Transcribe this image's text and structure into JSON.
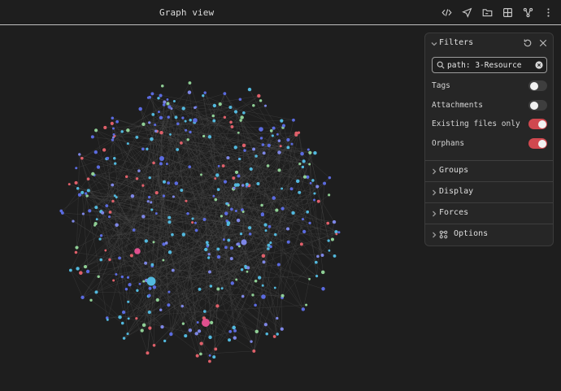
{
  "header": {
    "title": "Graph view",
    "toolbar": [
      {
        "name": "code-icon",
        "label": "Source mode"
      },
      {
        "name": "navigate-icon",
        "label": "Navigate"
      },
      {
        "name": "folder-icon",
        "label": "Folder"
      },
      {
        "name": "grid-icon",
        "label": "Layout"
      },
      {
        "name": "graph-icon",
        "label": "Graph"
      },
      {
        "name": "more-icon",
        "label": "More options"
      }
    ]
  },
  "filters": {
    "title": "Filters",
    "search_value": "path: 3-Resource",
    "toggles": [
      {
        "label": "Tags",
        "on": false
      },
      {
        "label": "Attachments",
        "on": false
      },
      {
        "label": "Existing files only",
        "on": true
      },
      {
        "label": "Orphans",
        "on": true
      }
    ]
  },
  "sections": {
    "groups": "Groups",
    "display": "Display",
    "forces": "Forces",
    "options": "Options"
  },
  "colors": {
    "background": "#1e1e1e",
    "toggle_on": "#d0484f",
    "node_blue": "#5b6be0",
    "node_periwinkle": "#7d86e6",
    "node_cyan": "#52b9de",
    "node_green": "#8fcf95",
    "node_red": "#e0606a",
    "node_pink": "#e0508e"
  }
}
